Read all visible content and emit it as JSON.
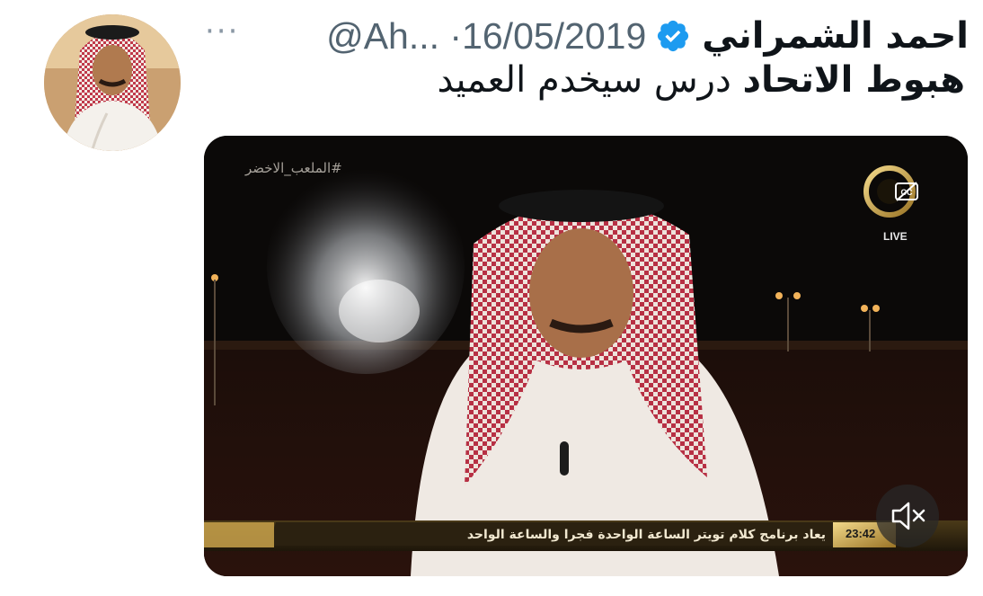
{
  "tweet": {
    "author_name": "احمد الشمراني",
    "handle_date": "@Ah... ·16/05/2019",
    "more_label": "···",
    "text_bold": "هبوط الاتحاد",
    "text_rest": " درس سيخدم العميد"
  },
  "video": {
    "hashtag": "#الملعب_الاخضر",
    "live_label": "LIVE",
    "ticker": "يعاد برنامج كلام تويتر الساعة الواحدة فجرا والساعة الواحد",
    "clock": "23:42",
    "mute_icon": "speaker-muted-icon",
    "cc_icon": "closed-captions-icon"
  },
  "colors": {
    "text": "#0f1419",
    "secondary": "#536471",
    "verified": "#1d9bf0",
    "gold": "#c9a24b"
  }
}
